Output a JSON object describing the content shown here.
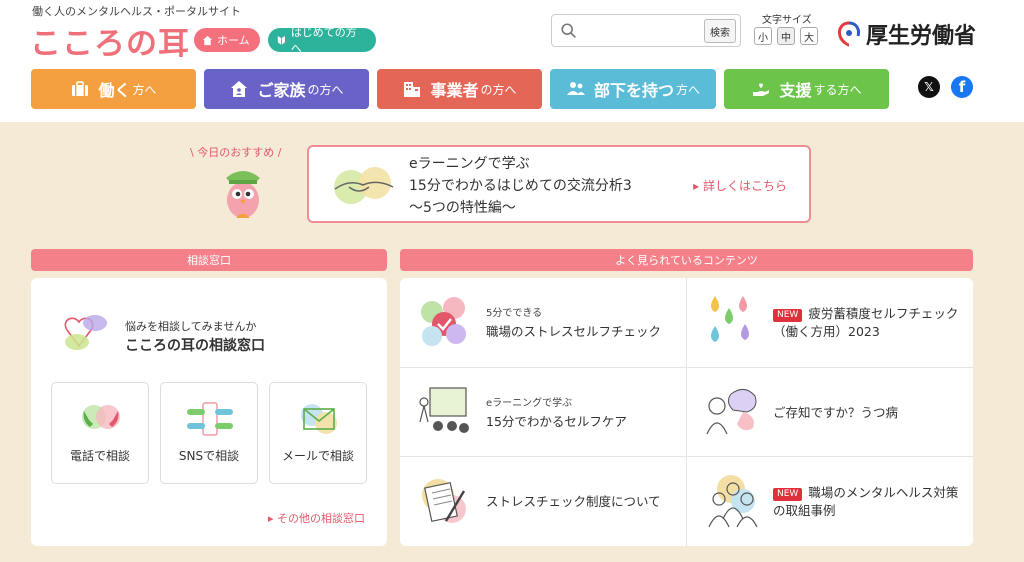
{
  "header": {
    "tagline": "働く人のメンタルヘルス・ポータルサイト",
    "logo": "こころの耳",
    "home_label": "ホーム",
    "first_label": "はじめての方へ",
    "search": {
      "placeholder": "",
      "button": "検索"
    },
    "font_size": {
      "label": "文字サイズ",
      "small": "小",
      "medium": "中",
      "large": "大",
      "selected": "中"
    },
    "ministry": "厚生労働省"
  },
  "nav": [
    {
      "big": "働く",
      "small": "方へ",
      "color": "#f5a040",
      "icon": "briefcase-icon"
    },
    {
      "big": "ご家族",
      "small": "の方へ",
      "color": "#6a63c7",
      "icon": "house-icon"
    },
    {
      "big": "事業者",
      "small": "の方へ",
      "color": "#e36656",
      "icon": "building-icon"
    },
    {
      "big": "部下を持つ",
      "small": "方へ",
      "color": "#5bbcd8",
      "icon": "people-icon"
    },
    {
      "big": "支援",
      "small": "する方へ",
      "color": "#6cc44a",
      "icon": "helping-hand-icon"
    }
  ],
  "social": {
    "x": "𝕏",
    "facebook": "f"
  },
  "recommend": {
    "label": "\\ 今日のおすすめ /",
    "line1": "eラーニングで学ぶ",
    "line2": "15分でわかるはじめての交流分析3",
    "line3": "〜5つの特性編〜",
    "more": "▸ 詳しくはこちら"
  },
  "consult": {
    "heading": "相談窓口",
    "sub": "悩みを相談してみませんか",
    "title": "こころの耳の相談窓口",
    "cards": [
      "電話で相談",
      "SNSで相談",
      "メールで相談"
    ],
    "other": "▸ その他の相談窓口"
  },
  "popular": {
    "heading": "よく見られているコンテンツ",
    "items": [
      {
        "sub": "5分でできる",
        "title": "職場のストレスセルフチェック",
        "new": ""
      },
      {
        "sub": "",
        "title": "疲労蓄積度セルフチェック（働く方用）2023",
        "new": "NEW"
      },
      {
        "sub": "eラーニングで学ぶ",
        "title": "15分でわかるセルフケア",
        "new": ""
      },
      {
        "sub": "",
        "title": "ご存知ですか？うつ病",
        "new": ""
      },
      {
        "sub": "",
        "title": "ストレスチェック制度について",
        "new": ""
      },
      {
        "sub": "",
        "title": "職場のメンタルヘルス対策の取組事例",
        "new": "NEW"
      }
    ]
  },
  "colors": {
    "accent": "#f0707a",
    "teal": "#2db39b",
    "background": "#f4ead6",
    "link": "#e2586a"
  }
}
